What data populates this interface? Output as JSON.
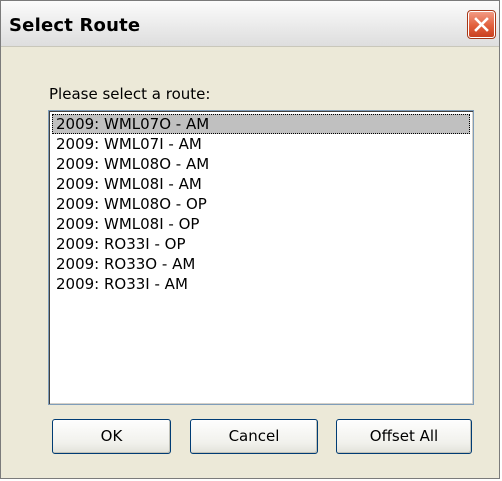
{
  "window": {
    "title": "Select Route"
  },
  "dialog": {
    "prompt": "Please select a route:",
    "selected_index": 0,
    "routes": [
      "2009: WML07O - AM",
      "2009: WML07I - AM",
      "2009: WML08O - AM",
      "2009: WML08I - AM",
      "2009: WML08O - OP",
      "2009: WML08I - OP",
      "2009: RO33I - OP",
      "2009: RO33O - AM",
      "2009: RO33I - AM"
    ]
  },
  "buttons": {
    "ok_label": "OK",
    "cancel_label": "Cancel",
    "offset_all_label": "Offset All"
  },
  "icons": {
    "close": "close-icon"
  },
  "colors": {
    "dialog_background": "#ece9d8",
    "close_button": "#e2603d",
    "selection": "#c0c0c0",
    "list_border": "#7f9db9"
  }
}
